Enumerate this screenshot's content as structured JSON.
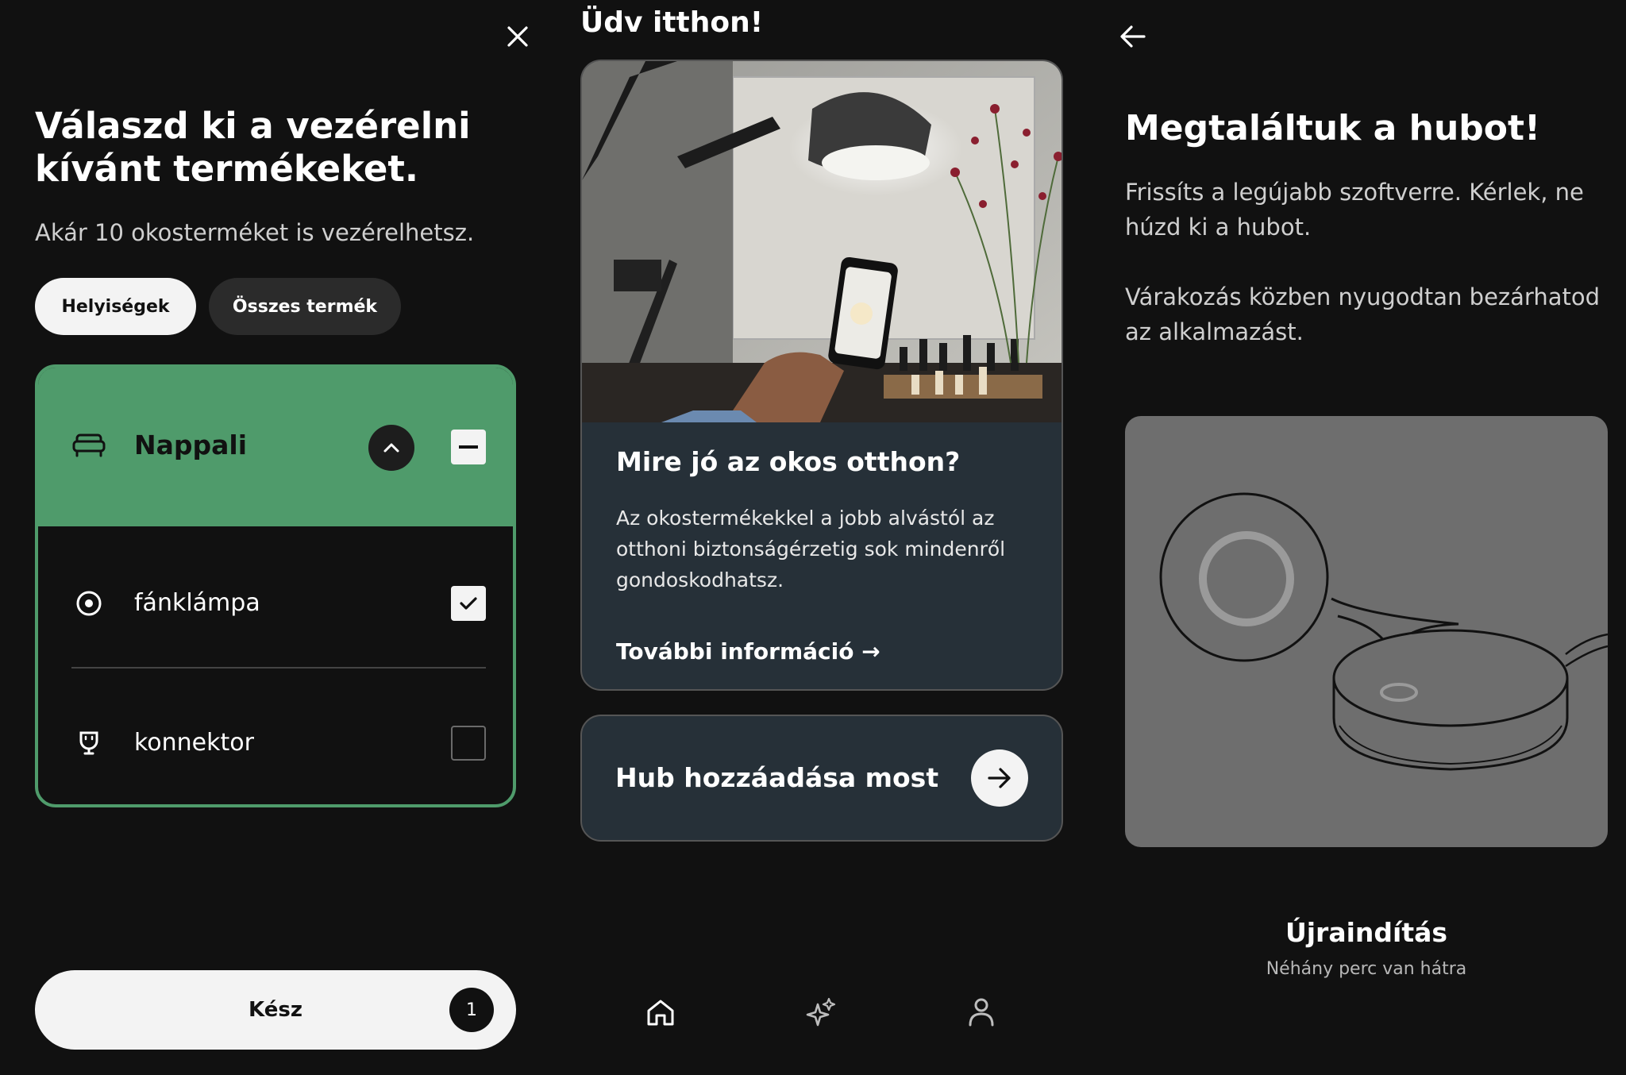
{
  "panel1": {
    "title": "Válaszd ki a vezérelni kívánt termékeket.",
    "subtitle": "Akár 10 okosterméket is vezérelhetsz.",
    "tabs": [
      {
        "label": "Helyiségek",
        "active": true
      },
      {
        "label": "Összes termék",
        "active": false
      }
    ],
    "room": {
      "name": "Nappali",
      "icon": "sofa-icon",
      "devices": [
        {
          "label": "fánklámpa",
          "icon": "lamp-icon",
          "checked": true
        },
        {
          "label": "konnektor",
          "icon": "plug-icon",
          "checked": false
        }
      ]
    },
    "done_button": {
      "label": "Kész",
      "count": "1"
    }
  },
  "panel2": {
    "title": "Üdv itthon!",
    "card": {
      "heading": "Mire jó az okos otthon?",
      "body": "Az okostermékekkel a jobb alvástól az otthoni biztonságérzetig sok mindenről gondoskodhatsz.",
      "link": "További információ →"
    },
    "hub_card": {
      "label": "Hub hozzáadása most"
    },
    "nav": [
      {
        "icon": "home-icon"
      },
      {
        "icon": "sparkle-icon"
      },
      {
        "icon": "profile-icon"
      }
    ]
  },
  "panel3": {
    "title": "Megtaláltuk a hubot!",
    "paragraph1": "Frissíts a legújabb szoftverre. Kérlek, ne húzd ki a hubot.",
    "paragraph2": "Várakozás közben nyugodtan bezárhatod az alkalmazást.",
    "status_title": "Újraindítás",
    "status_subtitle": "Néhány perc van hátra"
  },
  "colors": {
    "background": "#111111",
    "accent_green": "#4f9b6b",
    "card_bg": "#263038",
    "pill_light": "#f3f3f3"
  }
}
